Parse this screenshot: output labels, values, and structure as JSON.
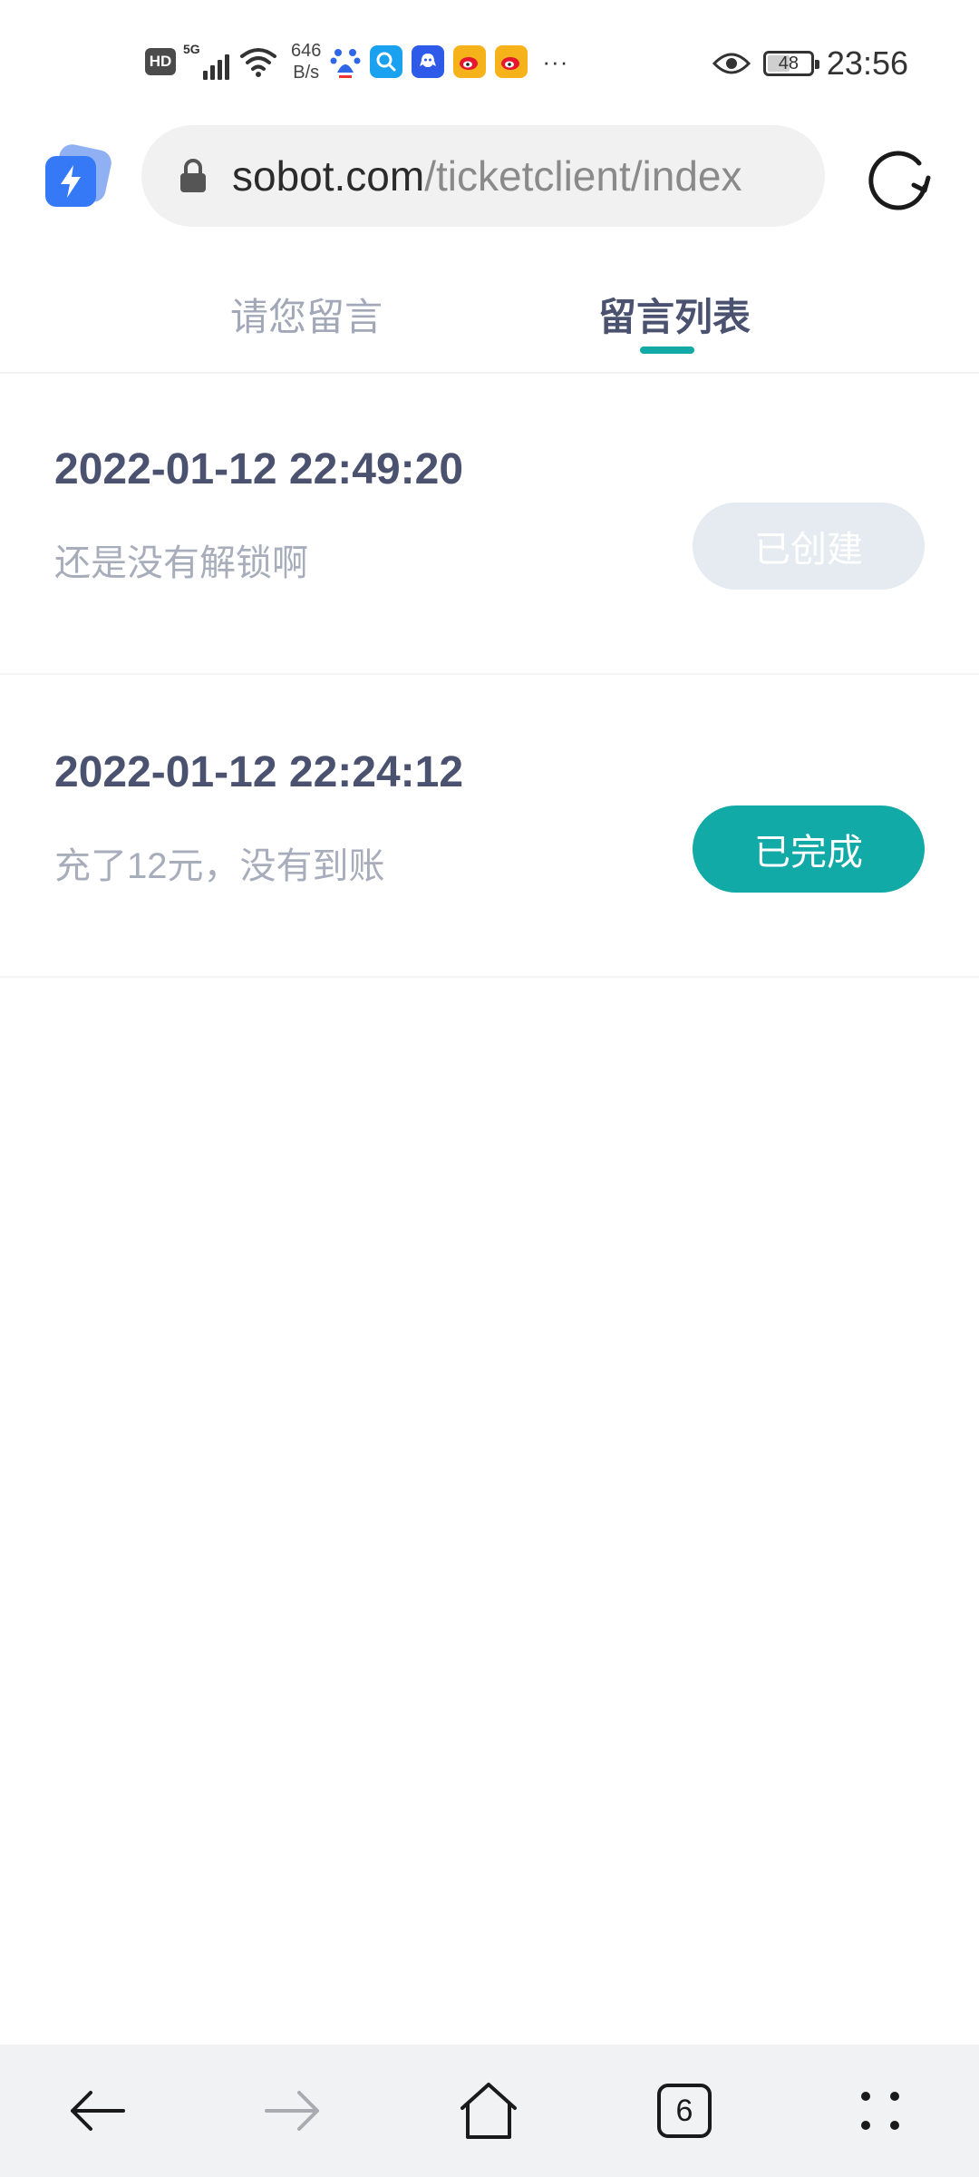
{
  "status_bar": {
    "hd_badge": "HD",
    "network_type": "5G",
    "net_speed_value": "646",
    "net_speed_unit": "B/s",
    "app_icons": [
      "baidu-icon",
      "search-app-icon",
      "qq-icon",
      "weibo-icon",
      "weibo-icon"
    ],
    "more": "···",
    "battery_level": "48",
    "time": "23:56"
  },
  "browser": {
    "url_domain": "sobot.com",
    "url_path": "/ticketclient/index"
  },
  "tabs": [
    {
      "label": "请您留言",
      "active": false
    },
    {
      "label": "留言列表",
      "active": true
    }
  ],
  "tickets": [
    {
      "time": "2022-01-12 22:49:20",
      "description": "还是没有解锁啊",
      "status": "已创建"
    },
    {
      "time": "2022-01-12 22:24:12",
      "description": "充了12元，没有到账",
      "status": "已完成"
    }
  ],
  "bottom_nav": {
    "tab_count": "6"
  },
  "colors": {
    "accent": "#12aaa6",
    "text_dark": "#4a5270",
    "text_muted": "#a7adba",
    "status_created_bg": "#e6ebf1",
    "nav_bg": "#f1f2f4"
  }
}
